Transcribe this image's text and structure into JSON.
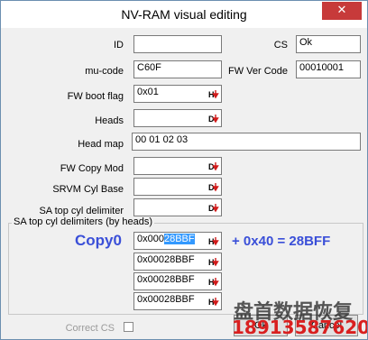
{
  "window": {
    "title": "NV-RAM visual editing",
    "close_glyph": "✕"
  },
  "fields": {
    "id": {
      "label": "ID",
      "value": ""
    },
    "cs": {
      "label": "CS",
      "value": "Ok"
    },
    "mu_code": {
      "label": "mu-code",
      "value": "C60F"
    },
    "fw_ver_code": {
      "label": "FW Ver Code",
      "value": "00010001"
    },
    "fw_boot_flag": {
      "label": "FW boot flag",
      "value": "0x01",
      "button_icon": "hex-down-arrow-icon"
    },
    "heads": {
      "label": "Heads",
      "value": "",
      "button_icon": "dec-down-arrow-icon"
    },
    "head_map": {
      "label": "Head map",
      "value": "00  01  02  03"
    },
    "fw_copy_mod": {
      "label": "FW Copy Mod",
      "value": "",
      "button_icon": "dec-down-arrow-icon"
    },
    "srvm_cyl_base": {
      "label": "SRVM Cyl Base",
      "value": "",
      "button_icon": "dec-down-arrow-icon"
    },
    "sa_top_cyl_delimiter": {
      "label": "SA top cyl delimiter",
      "value": "",
      "button_icon": "dec-down-arrow-icon"
    }
  },
  "sa_group": {
    "title": "SA top cyl delimiters (by heads)",
    "rows": [
      {
        "prefix": "0x000",
        "highlight": "28BBF",
        "button_icon": "hex-down-arrow-icon"
      },
      {
        "prefix": "0x00028BBF",
        "highlight": "",
        "button_icon": "hex-down-arrow-icon"
      },
      {
        "prefix": "0x00028BBF",
        "highlight": "",
        "button_icon": "hex-down-arrow-icon"
      },
      {
        "prefix": "0x00028BBF",
        "highlight": "",
        "button_icon": "hex-down-arrow-icon"
      }
    ]
  },
  "annotations": {
    "copy_label": "Copy0",
    "calc": "+ 0x40 = 28BFF"
  },
  "footer": {
    "correct_cs_label": "Correct CS",
    "ok_label": "Ok",
    "cancel_label": "Cancel"
  },
  "watermark": {
    "text": "盘首数据恢复",
    "phone": "18913587620"
  },
  "colors": {
    "annotation": "#3a4fd8",
    "arrow_red": "#d11a1a",
    "selection": "#3399ff"
  }
}
